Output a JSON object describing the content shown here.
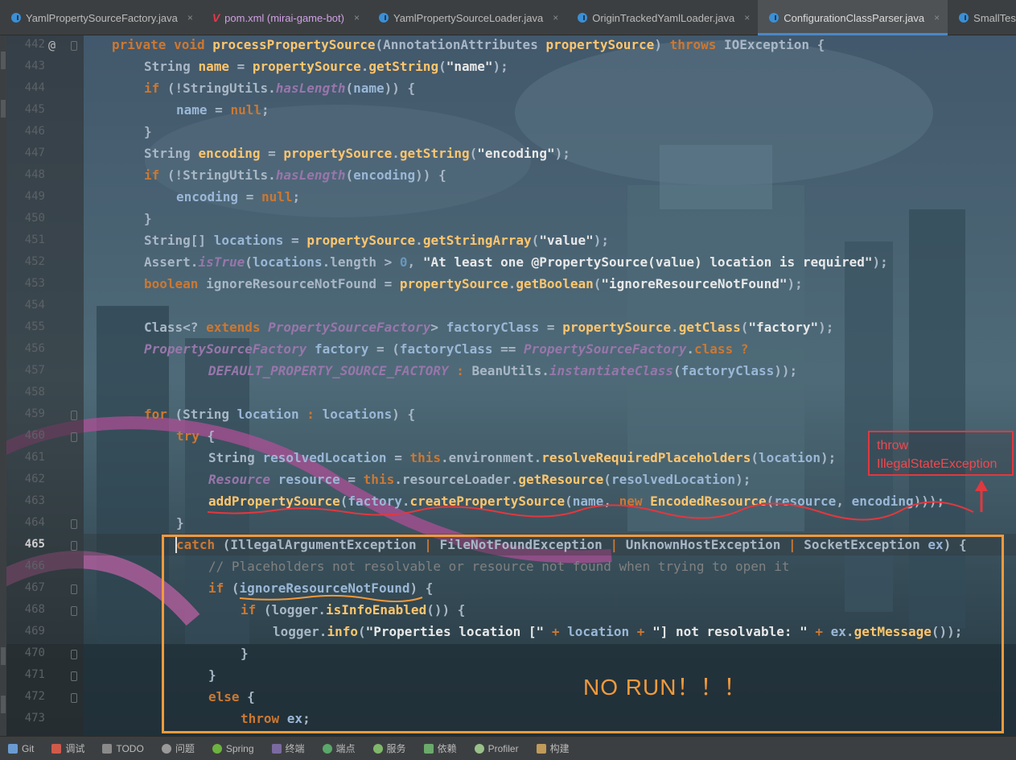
{
  "tabs": [
    {
      "label": "YamlPropertySourceFactory.java",
      "icon": "java-class-icon"
    },
    {
      "label": "pom.xml (mirai-game-bot)",
      "icon": "maven-icon"
    },
    {
      "label": "YamlPropertySourceLoader.java",
      "icon": "java-class-icon"
    },
    {
      "label": "OriginTrackedYamlLoader.java",
      "icon": "java-class-icon"
    },
    {
      "label": "ConfigurationClassParser.java",
      "icon": "java-class-icon",
      "active": true
    },
    {
      "label": "SmallTest.java",
      "icon": "java-class-icon"
    }
  ],
  "tab_close_glyph": "×",
  "gutter": {
    "annotation_glyph": "@",
    "line_numbers": [
      "442",
      "443",
      "444",
      "445",
      "446",
      "447",
      "448",
      "449",
      "450",
      "451",
      "452",
      "453",
      "454",
      "455",
      "456",
      "457",
      "458",
      "459",
      "460",
      "461",
      "462",
      "463",
      "464",
      "465",
      "466",
      "467",
      "468",
      "469",
      "470",
      "471",
      "472",
      "473"
    ],
    "current_line": "465"
  },
  "annotations": {
    "red_box_line1": "throw",
    "red_box_line2": "IllegalStateException",
    "no_run": "NO RUN！！！",
    "colors": {
      "red": "#e2383f",
      "orange": "#f39a3c"
    }
  },
  "statusbar": [
    {
      "label": "Git",
      "icon": "git-icon"
    },
    {
      "label": "调试",
      "icon": "debug-icon"
    },
    {
      "label": "TODO",
      "icon": "todo-icon"
    },
    {
      "label": "问题",
      "icon": "problems-icon"
    },
    {
      "label": "Spring",
      "icon": "spring-icon"
    },
    {
      "label": "终端",
      "icon": "terminal-icon"
    },
    {
      "label": "端点",
      "icon": "endpoints-icon"
    },
    {
      "label": "服务",
      "icon": "services-icon"
    },
    {
      "label": "依赖",
      "icon": "dependencies-icon"
    },
    {
      "label": "Profiler",
      "icon": "profiler-icon"
    },
    {
      "label": "构建",
      "icon": "build-icon"
    }
  ]
}
